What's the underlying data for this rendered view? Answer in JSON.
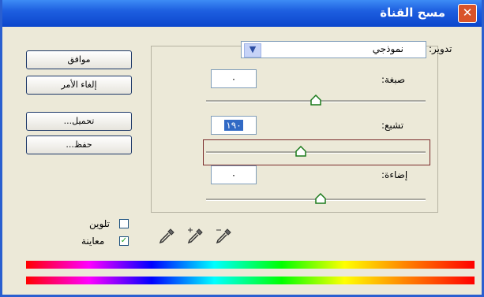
{
  "window": {
    "title": "مسح القناة",
    "close_label": "✕"
  },
  "buttons": {
    "ok": "موافق",
    "cancel": "إلغاء الأمر",
    "load": "تحميل...",
    "save": "حفظ..."
  },
  "channel": {
    "label": "تدوير:",
    "value": "نموذجي",
    "arrow": "▼"
  },
  "hue": {
    "label": "صبغة:",
    "value": "٠",
    "level": 0.5
  },
  "saturation": {
    "label": "تشبع:",
    "value": "١٩٠",
    "level": 0.43
  },
  "lightness": {
    "label": "إضاءة:",
    "value": "٠",
    "level": 0.52
  },
  "checkboxes": {
    "colorize": {
      "label": "تلوين",
      "checked": false
    },
    "preview": {
      "label": "معاينة",
      "checked": true,
      "mark": "✓"
    }
  },
  "icons": [
    "eyedropper-icon",
    "eyedropper-plus-icon",
    "eyedropper-minus-icon"
  ]
}
